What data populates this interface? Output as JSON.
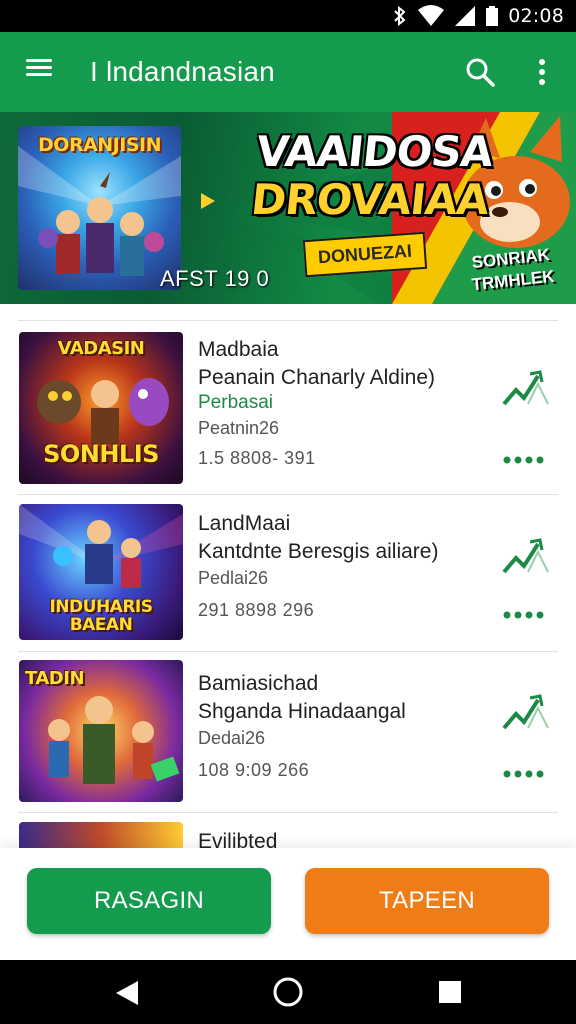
{
  "status_bar": {
    "time": "02:08"
  },
  "app_bar": {
    "title": "I lndandnasian"
  },
  "banner": {
    "poster_title": "DORANJISIN",
    "headline_line1": "VAAIDOSA",
    "headline_line2": "DROVAIAA",
    "tag": "DONUEZAI",
    "meta": "AFST 19   0",
    "badge_line1": "SONRIAK",
    "badge_line2": "TRMHLEK"
  },
  "items": [
    {
      "thumb_label": "SONHLIS",
      "thumb_top_label": "VADASIN",
      "title": "Madbaia",
      "subtitle": "Peanain Chanarly Aldine)",
      "category": "Perbasai",
      "meta1": "Peatnin26",
      "meta2": "1.5  8808-  391"
    },
    {
      "thumb_label": "INDUHARIS BAEAN",
      "thumb_top_label": "",
      "title": "LandMaai",
      "subtitle": "Kantdnte Beresgis ailiare)",
      "category": "",
      "meta1": "Pedlai26",
      "meta2": "291  8898   296"
    },
    {
      "thumb_label": "",
      "thumb_top_label": "TADIN",
      "title": "Bamiasichad",
      "subtitle": "Shganda Hinadaangal",
      "category": "",
      "meta1": "Dedai26",
      "meta2": "108  9:09   266"
    },
    {
      "thumb_label": "",
      "thumb_top_label": "",
      "title": "Evilibted",
      "subtitle": "",
      "category": "",
      "meta1": "",
      "meta2": ""
    }
  ],
  "buttons": {
    "left_label": "RASAGIN",
    "right_label": "TAPEEN"
  },
  "colors": {
    "primary": "#149b4d",
    "accent": "#f07c16",
    "category_text": "#1c8a45"
  },
  "icons": [
    "menu-icon",
    "search-icon",
    "more-vert-icon",
    "trending-up-icon",
    "more-horiz-icon",
    "back-icon",
    "home-icon",
    "recents-icon"
  ]
}
